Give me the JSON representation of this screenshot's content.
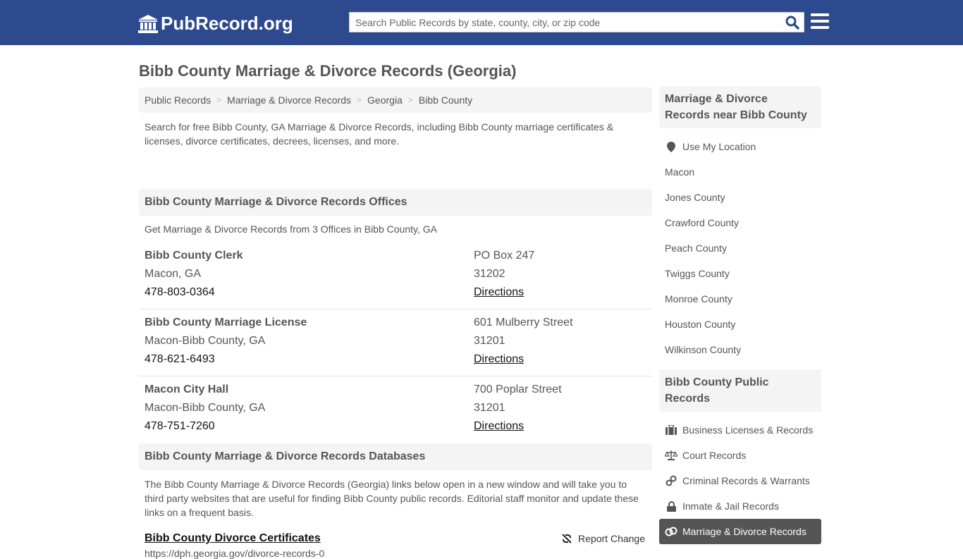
{
  "header": {
    "logo_text": "PubRecord.org",
    "search_placeholder": "Search Public Records by state, county, city, or zip code"
  },
  "page_title": "Bibb County Marriage & Divorce Records (Georgia)",
  "breadcrumb": [
    "Public Records",
    "Marriage & Divorce Records",
    "Georgia",
    "Bibb County"
  ],
  "intro": "Search for free Bibb County, GA Marriage & Divorce Records, including Bibb County marriage certificates & licenses, divorce certificates, decrees, licenses, and more.",
  "offices_section": {
    "title": "Bibb County Marriage & Divorce Records Offices",
    "subtext": "Get Marriage & Divorce Records from 3 Offices in Bibb County, GA",
    "offices": [
      {
        "name": "Bibb County Clerk",
        "city": "Macon, GA",
        "phone": "478-803-0364",
        "address": "PO Box 247",
        "zip": "31202",
        "directions": "Directions"
      },
      {
        "name": "Bibb County Marriage License",
        "city": "Macon-Bibb County, GA",
        "phone": "478-621-6493",
        "address": "601 Mulberry Street",
        "zip": "31201",
        "directions": "Directions"
      },
      {
        "name": "Macon City Hall",
        "city": "Macon-Bibb County, GA",
        "phone": "478-751-7260",
        "address": "700 Poplar Street",
        "zip": "31201",
        "directions": "Directions"
      }
    ]
  },
  "databases_section": {
    "title": "Bibb County Marriage & Divorce Records Databases",
    "subtext": "The Bibb County Marriage & Divorce Records (Georgia) links below open in a new window and will take you to third party websites that are useful for finding Bibb County public records. Editorial staff monitor and update these links on a frequent basis.",
    "items": [
      {
        "title": "Bibb County Divorce Certificates",
        "url": "https://dph.georgia.gov/divorce-records-0",
        "report_label": "Report Change"
      }
    ]
  },
  "sidebar": {
    "nearby_title": "Marriage & Divorce Records near Bibb County",
    "use_location": "Use My Location",
    "nearby": [
      "Macon",
      "Jones County",
      "Crawford County",
      "Peach County",
      "Twiggs County",
      "Monroe County",
      "Houston County",
      "Wilkinson County"
    ],
    "public_title": "Bibb County Public Records",
    "public": [
      {
        "label": "Business Licenses & Records",
        "icon": "briefcase-icon"
      },
      {
        "label": "Court Records",
        "icon": "scale-icon"
      },
      {
        "label": "Criminal Records & Warrants",
        "icon": "handcuffs-icon"
      },
      {
        "label": "Inmate & Jail Records",
        "icon": "lock-icon"
      },
      {
        "label": "Marriage & Divorce Records",
        "icon": "rings-icon",
        "active": true
      }
    ]
  }
}
